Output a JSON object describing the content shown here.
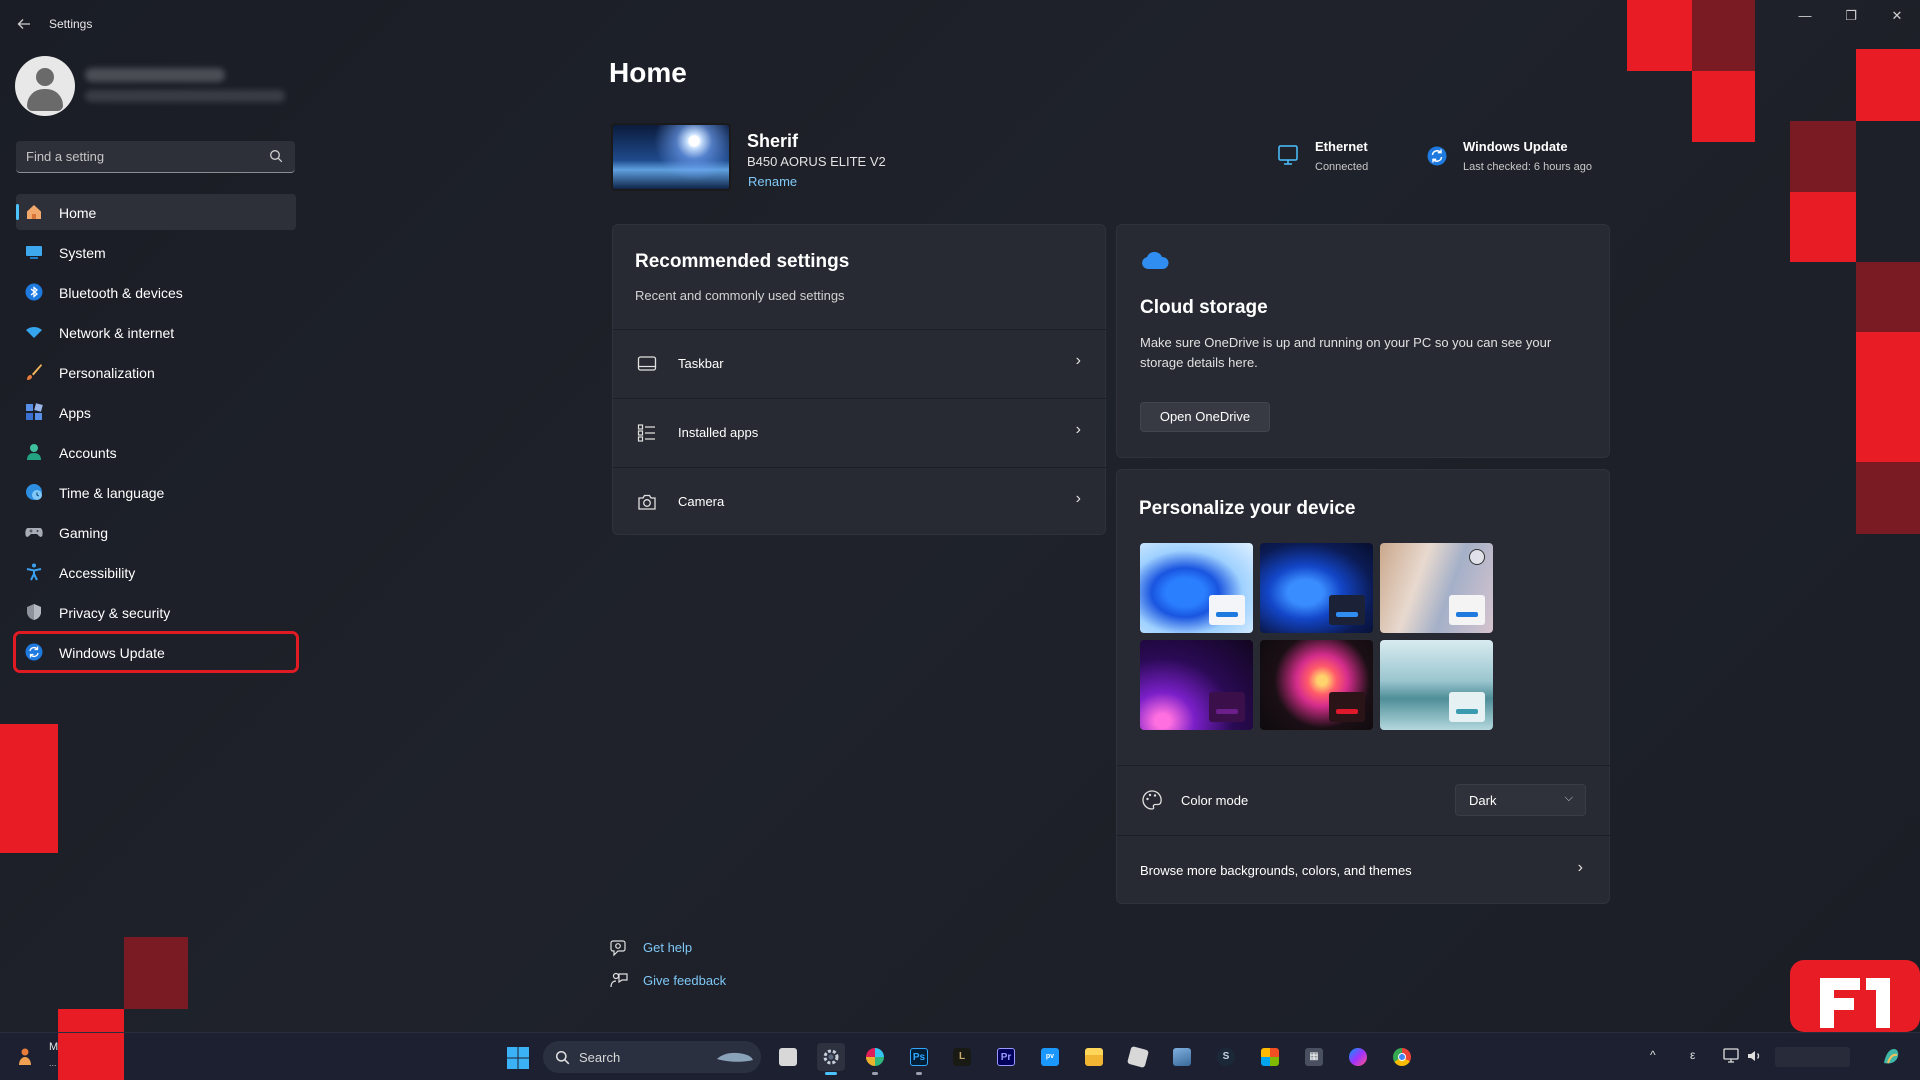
{
  "window": {
    "title": "Settings",
    "controls": {
      "minimize": "—",
      "maximize": "❐",
      "close": "✕"
    }
  },
  "sidebar": {
    "search_placeholder": "Find a setting",
    "items": [
      {
        "label": "Home",
        "icon": "home-icon"
      },
      {
        "label": "System",
        "icon": "system-icon"
      },
      {
        "label": "Bluetooth & devices",
        "icon": "bluetooth-icon"
      },
      {
        "label": "Network & internet",
        "icon": "network-icon"
      },
      {
        "label": "Personalization",
        "icon": "brush-icon"
      },
      {
        "label": "Apps",
        "icon": "apps-icon"
      },
      {
        "label": "Accounts",
        "icon": "accounts-icon"
      },
      {
        "label": "Time & language",
        "icon": "globe-clock-icon"
      },
      {
        "label": "Gaming",
        "icon": "gamepad-icon"
      },
      {
        "label": "Accessibility",
        "icon": "accessibility-icon"
      },
      {
        "label": "Privacy & security",
        "icon": "shield-icon"
      },
      {
        "label": "Windows Update",
        "icon": "update-icon"
      }
    ],
    "active_index": 0,
    "highlighted_index": 11
  },
  "main": {
    "title": "Home",
    "device": {
      "name": "Sherif",
      "model": "B450 AORUS ELITE V2",
      "rename": "Rename"
    },
    "status": {
      "ethernet": {
        "title": "Ethernet",
        "sub": "Connected"
      },
      "update": {
        "title": "Windows Update",
        "sub": "Last checked: 6 hours ago"
      }
    },
    "recommended": {
      "title": "Recommended settings",
      "subtitle": "Recent and commonly used settings",
      "rows": [
        {
          "label": "Taskbar",
          "icon": "taskbar-icon"
        },
        {
          "label": "Installed apps",
          "icon": "list-icon"
        },
        {
          "label": "Camera",
          "icon": "camera-icon"
        }
      ]
    },
    "cloud": {
      "title": "Cloud storage",
      "description": "Make sure OneDrive is up and running on your PC so you can see your storage details here.",
      "button": "Open OneDrive"
    },
    "personalize": {
      "title": "Personalize your device",
      "color_mode_label": "Color mode",
      "color_mode_value": "Dark",
      "browse": "Browse more backgrounds, colors, and themes"
    },
    "links": {
      "help": "Get help",
      "feedback": "Give feedback"
    }
  },
  "taskbar": {
    "left_line1": "M         toa...",
    "left_line2": "...",
    "search_label": "Search",
    "tray_chevron": "^",
    "tray_lang": "ε"
  },
  "colors": {
    "accent": "#4cc2ff",
    "link": "#7fc8f7",
    "highlight_red": "#e01b24",
    "card": "#272a32"
  }
}
